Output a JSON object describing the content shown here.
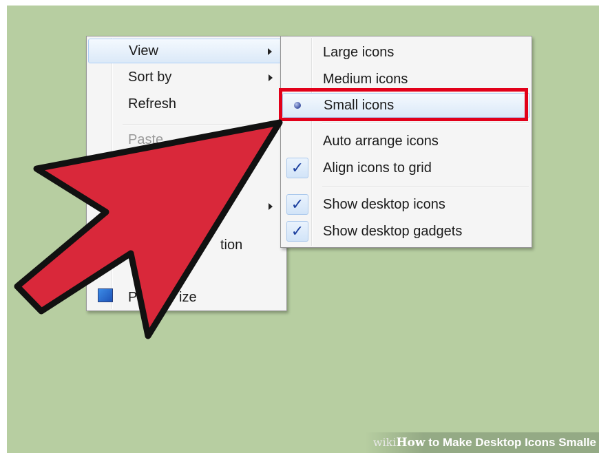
{
  "context_menu": {
    "items": [
      {
        "label": "View"
      },
      {
        "label": "Sort by"
      },
      {
        "label": "Refresh"
      },
      {
        "label": "Paste"
      },
      {
        "label": "tion"
      },
      {
        "label": "P",
        "label_tail": "ize"
      }
    ]
  },
  "view_submenu": {
    "items": [
      {
        "label": "Large icons"
      },
      {
        "label": "Medium icons"
      },
      {
        "label": "Small icons"
      },
      {
        "label": "Auto arrange icons"
      },
      {
        "label": "Align icons to grid"
      },
      {
        "label": "Show desktop icons"
      },
      {
        "label": "Show desktop gadgets"
      }
    ],
    "check_glyph": "✓"
  },
  "watermark": {
    "brand": "wiki",
    "how": "How",
    "rest": " to Make Desktop Icons Smalle"
  },
  "colors": {
    "desktop": "#b7cea1",
    "highlight_frame": "#e2001a",
    "pointer_arrow": "#d9283a"
  },
  "icons": [
    "radio-selected-icon",
    "checkmark-icon",
    "submenu-arrow-icon",
    "personalize-icon",
    "pointer-arrow-icon"
  ]
}
